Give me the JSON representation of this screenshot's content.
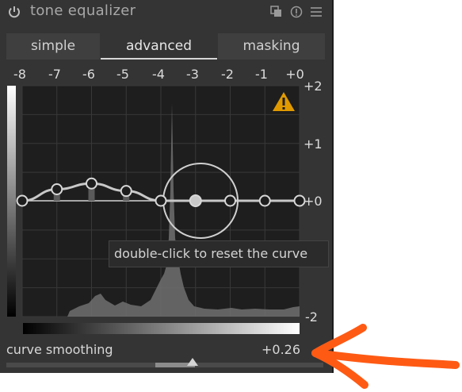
{
  "module": {
    "title": "tone equalizer",
    "header_icons": [
      "multi-instance-icon",
      "reset-icon",
      "presets-menu-icon"
    ]
  },
  "tabs": [
    {
      "label": "simple",
      "active": false
    },
    {
      "label": "advanced",
      "active": true
    },
    {
      "label": "masking",
      "active": false
    }
  ],
  "graph": {
    "x_ticks": [
      "-8",
      "-7",
      "-6",
      "-5",
      "-4",
      "-3",
      "-2",
      "-1",
      "+0"
    ],
    "y_ticks": [
      "+2",
      "+1",
      "+0",
      "-2"
    ],
    "warning_icon": "warning-triangle-icon",
    "warning_color": "#f0a000",
    "curve_nodes_ev": [
      0.0,
      0.2,
      0.3,
      0.17,
      0.0,
      0.0,
      0.0,
      0.0,
      0.0
    ],
    "selected_node_index": 5,
    "tooltip": "double-click to reset the curve"
  },
  "smoothing": {
    "label": "curve smoothing",
    "value": "+0.26",
    "position_fraction": 0.58
  },
  "annotation": {
    "color": "#ff5a14"
  }
}
